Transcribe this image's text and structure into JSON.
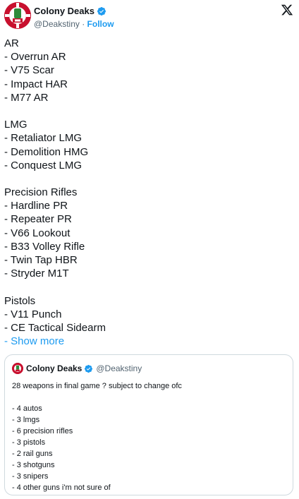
{
  "author": {
    "name": "Colony Deaks",
    "handle": "@Deakstiny",
    "separator": " · ",
    "follow_label": "Follow"
  },
  "icons": {
    "verified": "verified-badge-icon",
    "x_logo": "x-logo-icon"
  },
  "colors": {
    "accent": "#1d9bf0",
    "avatar": "#c8102e",
    "text": "#0f1419",
    "muted": "#536471"
  },
  "post": {
    "lines": [
      "AR",
      "- Overrun AR",
      "- V75 Scar",
      "- Impact HAR",
      "- M77 AR",
      "",
      "LMG",
      "- Retaliator LMG",
      "- Demolition HMG",
      "- Conquest LMG",
      "",
      "Precision Rifles",
      "- Hardline PR",
      "- Repeater PR",
      "- V66 Lookout",
      "- B33 Volley Rifle",
      "- Twin Tap HBR",
      "- Stryder M1T",
      "",
      "Pistols",
      "- V11 Punch",
      "- CE Tactical Sidearm"
    ],
    "show_more_prefix": "- ",
    "show_more_label": "Show more"
  },
  "quote": {
    "name": "Colony Deaks",
    "handle": "@Deakstiny",
    "lines": [
      "28 weapons in final game ? subject to change ofc",
      "",
      "- 4 autos",
      "- 3 lmgs",
      "- 6 precision rifles",
      "- 3 pistols",
      "- 2 rail guns",
      "- 3 shotguns",
      "- 3 snipers",
      "- 4 other guns i'm not sure of"
    ]
  }
}
